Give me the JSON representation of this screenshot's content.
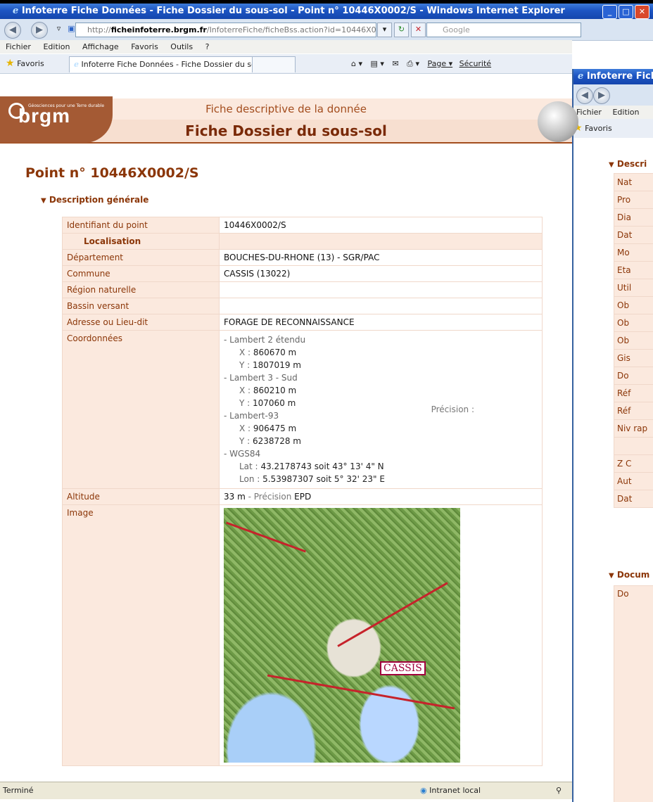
{
  "window": {
    "title": "Infoterre Fiche Données - Fiche Dossier du sous-sol - Point n° 10446X0002/S - Windows Internet Explorer",
    "url_prefix": "http://",
    "url_domain": "ficheinfoterre.brgm.fr",
    "url_path": "/InfoterreFiche/ficheBss.action?id=10446X0",
    "search_placeholder": "Google"
  },
  "menu": [
    "Fichier",
    "Edition",
    "Affichage",
    "Favoris",
    "Outils",
    "?"
  ],
  "favorites": {
    "label": "Favoris",
    "tab_title": "Infoterre Fiche Données - Fiche Dossier du sous-sol - ...",
    "commands": [
      "Page ▾",
      "Sécurité"
    ]
  },
  "header": {
    "logo": "brgm",
    "tagline": "Géosciences pour une Terre durable",
    "subtitle": "Fiche descriptive de la donnée",
    "title": "Fiche Dossier du sous-sol"
  },
  "point_title": "Point n° 10446X0002/S",
  "section_title": "Description générale",
  "fields": {
    "identifiant_label": "Identifiant du point",
    "identifiant": "10446X0002/S",
    "localisation": "Localisation",
    "departement_label": "Département",
    "departement": "BOUCHES-DU-RHONE (13) - SGR/PAC",
    "commune_label": "Commune",
    "commune": "CASSIS (13022)",
    "region_label": "Région naturelle",
    "region": "",
    "bassin_label": "Bassin versant",
    "bassin": "",
    "adresse_label": "Adresse ou Lieu-dit",
    "adresse": "FORAGE DE RECONNAISSANCE",
    "coord_label": "Coordonnées",
    "altitude_label": "Altitude",
    "altitude_value": "33 m",
    "altitude_prec_label": "Précision",
    "altitude_prec": "EPD",
    "image_label": "Image"
  },
  "coordinates": [
    {
      "system": "- Lambert 2 étendu",
      "x": "860670 m",
      "y": "1807019 m"
    },
    {
      "system": "- Lambert 3 - Sud",
      "x": "860210 m",
      "y": "107060 m"
    },
    {
      "system": "- Lambert-93",
      "x": "906475 m",
      "y": "6238728 m"
    }
  ],
  "wgs84": {
    "system": "- WGS84",
    "lat_label": "Lat :",
    "lat": "43.2178743 soit 43° 13' 4\" N",
    "lon_label": "Lon :",
    "lon": "5.53987307 soit 5° 32' 23\" E"
  },
  "x_label": "X :",
  "y_label": "Y :",
  "precision_label": "Précision :",
  "map_town": "CASSIS",
  "status": {
    "left": "Terminé",
    "zone": "Intranet local"
  },
  "second_window": {
    "title": "Infoterre Fich",
    "menu": [
      "Fichier",
      "Edition"
    ],
    "fav": "Favoris",
    "section1": "Descri",
    "rows": [
      "Nat",
      "Pro",
      "Dia",
      "Dat",
      "Mo",
      "Eta",
      "Util",
      "Ob",
      "Ob",
      "Ob",
      "Gis",
      "Do",
      "Réf",
      "Réf",
      "Niv rap",
      "",
      "Z C",
      "Aut",
      "Dat"
    ],
    "section2": "Docum",
    "doc": "Do"
  }
}
